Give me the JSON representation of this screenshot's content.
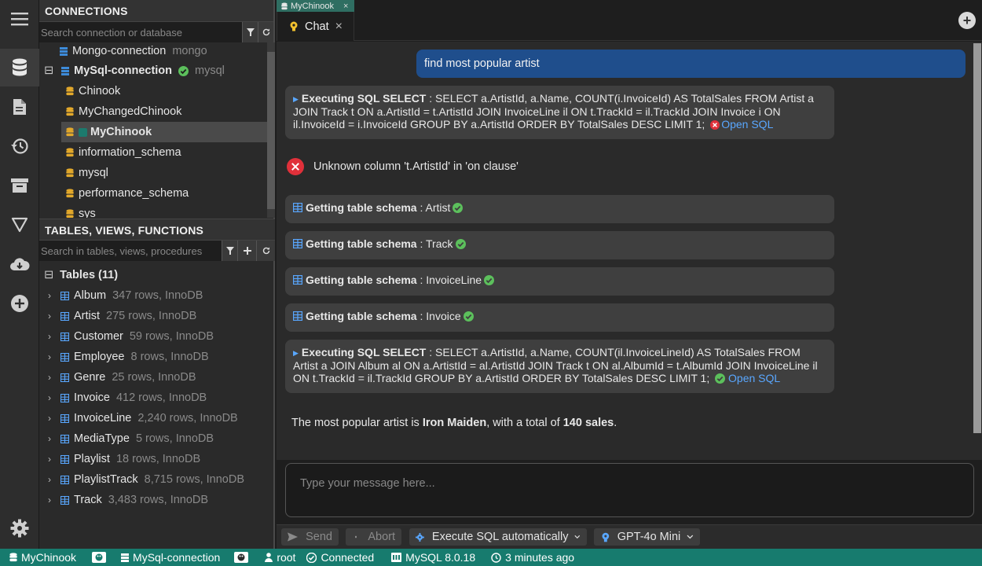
{
  "activity": {
    "items": [
      {
        "name": "menu",
        "icon": "hamburger-icon"
      },
      {
        "name": "database",
        "icon": "database-icon",
        "active": true
      },
      {
        "name": "file",
        "icon": "file-icon"
      },
      {
        "name": "history",
        "icon": "history-icon"
      },
      {
        "name": "archive",
        "icon": "archive-icon"
      },
      {
        "name": "filter",
        "icon": "filter-triangle-icon"
      },
      {
        "name": "cloud",
        "icon": "cloud-icon"
      },
      {
        "name": "add",
        "icon": "plus-circle-icon"
      },
      {
        "name": "settings",
        "icon": "gear-icon"
      }
    ]
  },
  "connections": {
    "title": "CONNECTIONS",
    "search_placeholder": "Search connection or database",
    "items": [
      {
        "label": "Mongo-connection",
        "engine": "mongo"
      },
      {
        "label": "MySql-connection",
        "engine": "mysql",
        "expand": "⊟"
      },
      {
        "label": "Chinook"
      },
      {
        "label": "MyChangedChinook"
      },
      {
        "label": "MyChinook"
      },
      {
        "label": "information_schema"
      },
      {
        "label": "mysql"
      },
      {
        "label": "performance_schema"
      },
      {
        "label": "sys"
      }
    ]
  },
  "tables": {
    "title": "TABLES, VIEWS, FUNCTIONS",
    "search_placeholder": "Search in tables, views, procedures",
    "group_label": "Tables (11)",
    "group_expand": "⊟",
    "rows": [
      {
        "name": "Album",
        "info": "347 rows, InnoDB"
      },
      {
        "name": "Artist",
        "info": "275 rows, InnoDB"
      },
      {
        "name": "Customer",
        "info": "59 rows, InnoDB"
      },
      {
        "name": "Employee",
        "info": "8 rows, InnoDB"
      },
      {
        "name": "Genre",
        "info": "25 rows, InnoDB"
      },
      {
        "name": "Invoice",
        "info": "412 rows, InnoDB"
      },
      {
        "name": "InvoiceLine",
        "info": "2,240 rows, InnoDB"
      },
      {
        "name": "MediaType",
        "info": "5 rows, InnoDB"
      },
      {
        "name": "Playlist",
        "info": "18 rows, InnoDB"
      },
      {
        "name": "PlaylistTrack",
        "info": "8,715 rows, InnoDB"
      },
      {
        "name": "Track",
        "info": "3,483 rows, InnoDB"
      }
    ]
  },
  "tabs": {
    "doc_tab": "MyChinook",
    "chat_tab": "Chat",
    "close_glyph": "×",
    "add_glyph": "+"
  },
  "chat": {
    "user_message": "find most popular artist",
    "sql1": {
      "label": "Executing SQL SELECT",
      "sep": " : ",
      "query": "SELECT a.ArtistId, a.Name, COUNT(i.InvoiceId) AS TotalSales FROM Artist a JOIN Track t ON a.ArtistId = t.ArtistId JOIN InvoiceLine il ON t.TrackId = il.TrackId JOIN Invoice i ON il.InvoiceId = i.InvoiceId GROUP BY a.ArtistId ORDER BY TotalSales DESC LIMIT 1;",
      "link": "Open SQL"
    },
    "error": "Unknown column 't.ArtistId' in 'on clause'",
    "schema_label": "Getting table schema",
    "schema_sep": " : ",
    "schemas": [
      "Artist",
      "Track",
      "InvoiceLine",
      "Invoice"
    ],
    "sql2": {
      "label": "Executing SQL SELECT",
      "sep": " : ",
      "query": "SELECT a.ArtistId, a.Name, COUNT(il.InvoiceLineId) AS TotalSales FROM Artist a JOIN Album al ON a.ArtistId = al.ArtistId JOIN Track t ON al.AlbumId = t.AlbumId JOIN InvoiceLine il ON t.TrackId = il.TrackId GROUP BY a.ArtistId ORDER BY TotalSales DESC LIMIT 1;",
      "link": "Open SQL"
    },
    "answer": {
      "prefix": "The most popular artist is ",
      "artist": "Iron Maiden",
      "middle": ", with a total of ",
      "sales": "140 sales",
      "suffix": "."
    },
    "input_placeholder": "Type your message here..."
  },
  "actions": {
    "send": "Send",
    "abort": "Abort",
    "execute": "Execute SQL automatically",
    "model": "GPT-4o Mini"
  },
  "status": {
    "database": "MyChinook",
    "connection": "MySql-connection",
    "user": "root",
    "state": "Connected",
    "server": "MySQL 8.0.18",
    "time": "3 minutes ago"
  },
  "colors": {
    "accent": "#177b6e",
    "user_bubble": "#1f4e8c",
    "link": "#59a7ff",
    "ok": "#5cc05c",
    "error": "#e0303a"
  }
}
